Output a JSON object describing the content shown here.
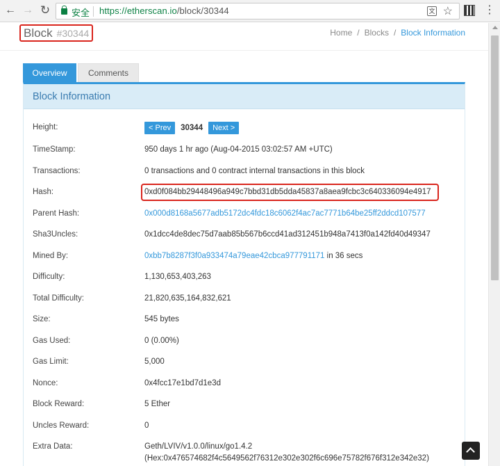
{
  "browser": {
    "secure_label": "安全",
    "url_domain": "https://etherscan.io",
    "url_path": "/block/30344"
  },
  "header": {
    "title": "Block",
    "block_number": "#30344"
  },
  "breadcrumb": [
    "Home",
    "/",
    "Blocks",
    "/",
    "Block Information"
  ],
  "tabs": {
    "overview": "Overview",
    "comments": "Comments"
  },
  "panel_title": "Block Information",
  "pager": {
    "prev": "< Prev",
    "number": "30344",
    "next": "Next >"
  },
  "fields": {
    "height": {
      "label": "Height:"
    },
    "timestamp": {
      "label": "TimeStamp:",
      "value": "950 days 1 hr ago (Aug-04-2015 03:02:57 AM +UTC)"
    },
    "transactions": {
      "label": "Transactions:",
      "value": "0 transactions and 0 contract internal transactions in this block"
    },
    "hash": {
      "label": "Hash:",
      "value": "0xd0f084bb29448496a949c7bbd31db5dda45837a8aea9fcbc3c640336094e4917"
    },
    "parent_hash": {
      "label": "Parent Hash:",
      "value": "0x000d8168a5677adb5172dc4fdc18c6062f4ac7ac7771b64be25ff2ddcd107577"
    },
    "sha3uncles": {
      "label": "Sha3Uncles:",
      "value": "0x1dcc4de8dec75d7aab85b567b6ccd41ad312451b948a7413f0a142fd40d49347"
    },
    "mined_by": {
      "label": "Mined By:",
      "value": "0xbb7b8287f3f0a933474a79eae42cbca977791171",
      "suffix": " in 36 secs"
    },
    "difficulty": {
      "label": "Difficulty:",
      "value": "1,130,653,403,263"
    },
    "total_difficulty": {
      "label": "Total Difficulty:",
      "value": "21,820,635,164,832,621"
    },
    "size": {
      "label": "Size:",
      "value": "545 bytes"
    },
    "gas_used": {
      "label": "Gas Used:",
      "value": "0 (0.00%)"
    },
    "gas_limit": {
      "label": "Gas Limit:",
      "value": "5,000"
    },
    "nonce": {
      "label": "Nonce:",
      "value": "0x4fcc17e1bd7d1e3d"
    },
    "block_reward": {
      "label": "Block Reward:",
      "value": "5 Ether"
    },
    "uncles_reward": {
      "label": "Uncles Reward:",
      "value": "0"
    },
    "extra_data": {
      "label": "Extra Data:",
      "value": "Geth/LVIV/v1.0.0/linux/go1.4.2",
      "value2": "(Hex:0x476574682f4c5649562f76312e302e302f6c696e75782f676f312e342e32)"
    }
  }
}
